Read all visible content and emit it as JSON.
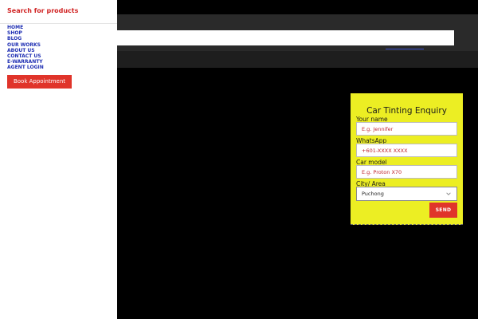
{
  "drawer": {
    "search_label": "Search for products",
    "menu": [
      {
        "label": "HOME"
      },
      {
        "label": "SHOP"
      },
      {
        "label": "BLOG"
      },
      {
        "label": "OUR WORKS"
      },
      {
        "label": "ABOUT US"
      },
      {
        "label": "CONTACT US"
      },
      {
        "label": "E-WARRANTY"
      },
      {
        "label": "AGENT LOGIN"
      }
    ],
    "book_button": "Book Appointment"
  },
  "enquiry_form": {
    "title": "Car Tinting Enquiry",
    "name_label": "Your name",
    "name_placeholder": "E.g. Jennifer",
    "whatsapp_label": "WhatsApp",
    "whatsapp_placeholder": "+601-XXXX XXXX",
    "car_model_label": "Car model",
    "car_model_placeholder": "E.g. Proton X70",
    "city_label": "City/ Area",
    "city_selected": "Puchong",
    "send_button": "SEND"
  },
  "colors": {
    "form_background": "#ecee23",
    "button_red": "#e0342a",
    "menu_link_blue": "#1f2fb3",
    "search_label_red": "#d12525",
    "page_background": "#000000"
  },
  "icons": {
    "city_dropdown": "chevron-down-icon"
  }
}
